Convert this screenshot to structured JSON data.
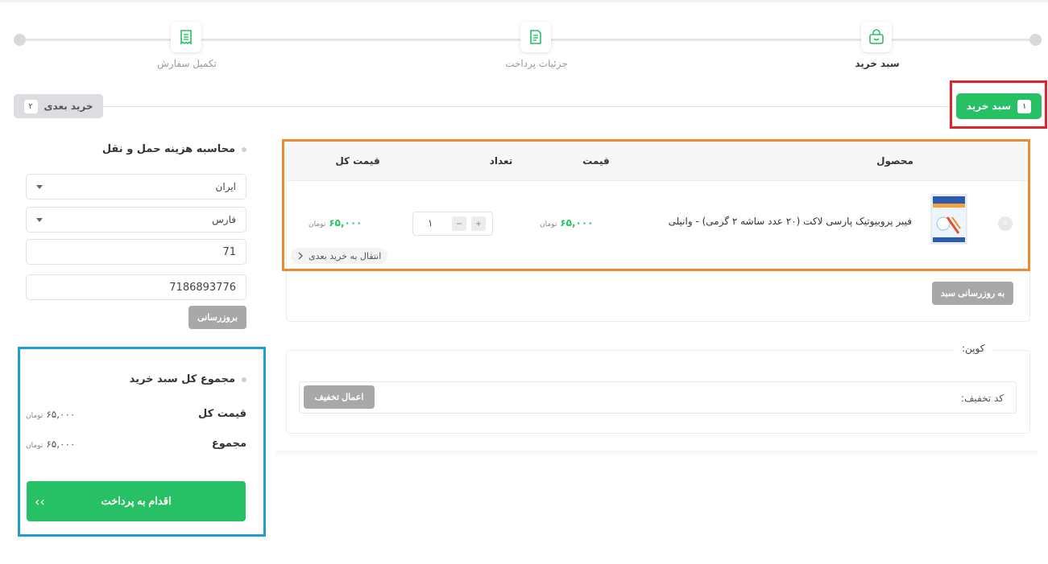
{
  "colors": {
    "accent": "#27c065",
    "highlight_red": "#e0242b",
    "highlight_orange": "#f08a32",
    "highlight_blue": "#1e9fd8"
  },
  "stepper": {
    "steps": [
      {
        "label": "سبد خرید",
        "icon": "shopping-bag-icon",
        "active": true
      },
      {
        "label": "جزئیات پرداخت",
        "icon": "document-icon",
        "active": false
      },
      {
        "label": "تکمیل سفارش",
        "icon": "receipt-icon",
        "active": false
      }
    ]
  },
  "tabs": {
    "cart": {
      "label": "سبد خرید",
      "num": "۱"
    },
    "next_cart": {
      "label": "خرید بعدی",
      "num": "۲"
    }
  },
  "shipping": {
    "title": "محاسبه هزینه حمل و نقل",
    "country": "ایران",
    "province": "فارس",
    "city": "71",
    "postcode": "7186893776",
    "update_label": "بروزرسانی"
  },
  "totals": {
    "title": "مجموع کل سبد خرید",
    "rows": [
      {
        "label": "قیمت کل",
        "value": "۶۵,۰۰۰",
        "currency": "تومان"
      },
      {
        "label": "مجموع",
        "value": "۶۵,۰۰۰",
        "currency": "تومان"
      }
    ],
    "checkout_label": "اقدام به پرداخت",
    "checkout_arrows": "‹‹"
  },
  "cart": {
    "headers": {
      "product": "محصول",
      "price": "قیمت",
      "quantity": "تعداد",
      "total": "قیمت کل"
    },
    "items": [
      {
        "name": "فیبر پروبیوتیک پارسی لاکت (۲۰ عدد ساشه ۲ گرمی) - وانیلی",
        "price": "۶۵,۰۰۰",
        "quantity": "۱",
        "total": "۶۵,۰۰۰",
        "currency": "تومان",
        "move_label": "انتقال به خرید بعدی"
      }
    ],
    "remove_icon": "×",
    "plus": "+",
    "minus": "−",
    "update_label": "به روزرسانی سبد"
  },
  "coupon": {
    "legend": "کوپن:",
    "label": "کد تخفیف:",
    "apply_label": "اعمال تخفیف"
  }
}
